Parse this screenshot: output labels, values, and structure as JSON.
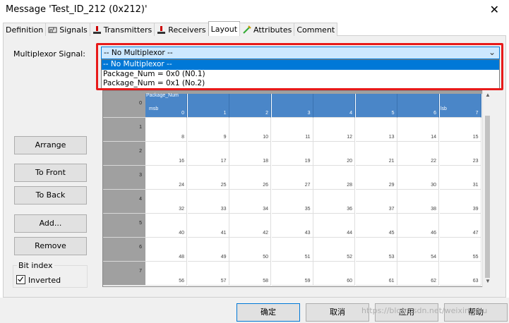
{
  "window": {
    "title": "Message 'Test_ID_212 (0x212)'",
    "close_glyph": "✕"
  },
  "tabs": [
    {
      "label": "Definition",
      "icon": ""
    },
    {
      "label": "Signals",
      "icon": "signals-icon"
    },
    {
      "label": "Transmitters",
      "icon": "transmitter-icon"
    },
    {
      "label": "Receivers",
      "icon": "receiver-icon"
    },
    {
      "label": "Layout",
      "icon": ""
    },
    {
      "label": "Attributes",
      "icon": "attributes-icon"
    },
    {
      "label": "Comment",
      "icon": ""
    }
  ],
  "layout": {
    "mux_label": "Multiplexor Signal:",
    "mux_value": "-- No Multiplexor --",
    "mux_options": [
      "-- No Multiplexor --",
      "Package_Num = 0x0 (N0.1)",
      "Package_Num = 0x1 (No.2)"
    ],
    "buttons": {
      "arrange": "Arrange",
      "to_front": "To Front",
      "to_back": "To Back",
      "add": "Add...",
      "remove": "Remove"
    },
    "bit_index_title": "Bit index",
    "inverted_label": "Inverted",
    "grid": {
      "signal_name": "Package_Num",
      "msb_label": "msb",
      "lsb_label": "lsb",
      "rows": [
        "0",
        "1",
        "2",
        "3",
        "4",
        "5",
        "6",
        "7"
      ],
      "bits": [
        [
          "0",
          "1",
          "2",
          "3",
          "4",
          "5",
          "6",
          "7"
        ],
        [
          "8",
          "9",
          "10",
          "11",
          "12",
          "13",
          "14",
          "15"
        ],
        [
          "16",
          "17",
          "18",
          "19",
          "20",
          "21",
          "22",
          "23"
        ],
        [
          "24",
          "25",
          "26",
          "27",
          "28",
          "29",
          "30",
          "31"
        ],
        [
          "32",
          "33",
          "34",
          "35",
          "36",
          "37",
          "38",
          "39"
        ],
        [
          "40",
          "41",
          "42",
          "43",
          "44",
          "45",
          "46",
          "47"
        ],
        [
          "48",
          "49",
          "50",
          "51",
          "52",
          "53",
          "54",
          "55"
        ],
        [
          "56",
          "57",
          "58",
          "59",
          "60",
          "61",
          "62",
          "63"
        ]
      ]
    }
  },
  "footer": {
    "ok": "确定",
    "cancel": "取消",
    "apply": "应用",
    "help": "帮助"
  },
  "watermark": "https://blog.csdn.net/weixin_zhu",
  "colors": {
    "accent": "#0078d7",
    "highlight": "#e81a1a",
    "signal": "#4a86c8"
  }
}
